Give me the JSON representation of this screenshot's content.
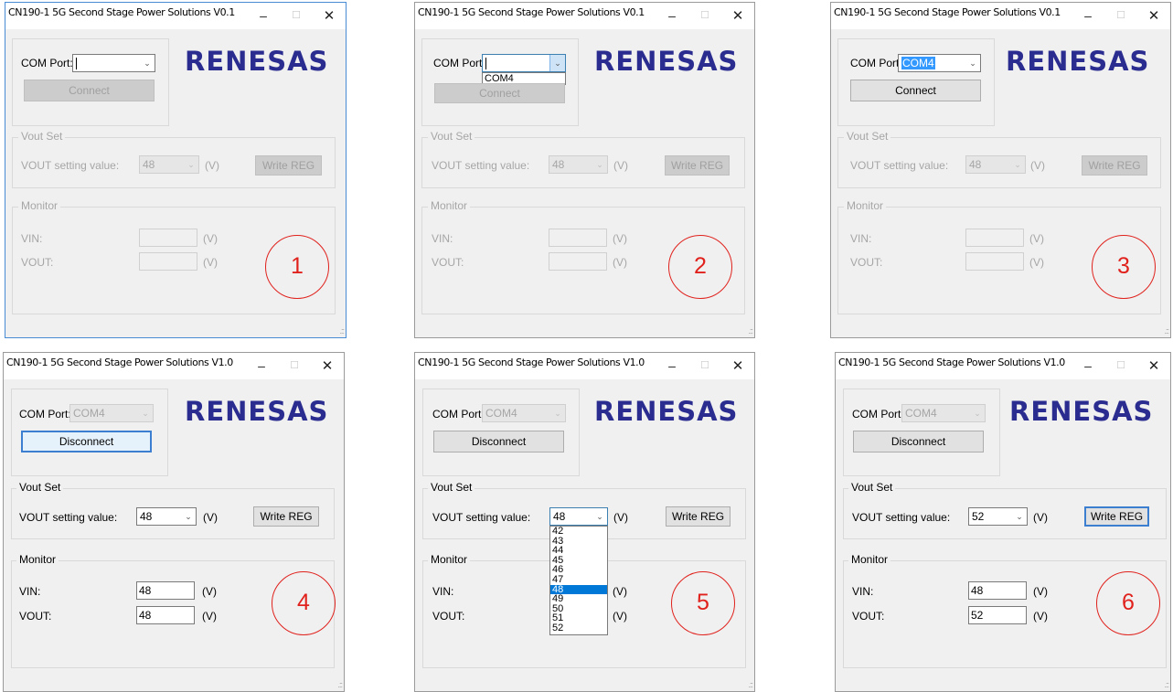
{
  "titles": {
    "v01": "CN190-1 5G Second Stage Power Solutions V0.1",
    "v10": "CN190-1 5G Second Stage Power Solutions V1.0"
  },
  "controls": {
    "minimize": "–",
    "maximize": "☐",
    "close": "✕",
    "grip": ".::",
    "dropdown_arrow": "⌄"
  },
  "labels": {
    "com_port": "COM Port:",
    "vout_set": "Vout Set",
    "vout_setting_value": "VOUT setting value:",
    "unit_v": "(V)",
    "monitor": "Monitor",
    "vin": "VIN:",
    "vout": "VOUT:",
    "connect": "Connect",
    "disconnect": "Disconnect",
    "write_reg": "Write REG"
  },
  "logo": "RENESAS",
  "colors": {
    "logo": "#2a2c8f",
    "annotation": "#e0211c",
    "highlight": "#3399ff",
    "active_border": "#4a8bd6"
  },
  "com_options": [
    "COM4"
  ],
  "vout_options": [
    "42",
    "43",
    "44",
    "45",
    "46",
    "47",
    "48",
    "49",
    "50",
    "51",
    "52"
  ],
  "panels": [
    {
      "step": "1",
      "com": "",
      "vout_sel": "48",
      "vin": "",
      "vout": ""
    },
    {
      "step": "2",
      "com": "",
      "vout_sel": "48",
      "vin": "",
      "vout": ""
    },
    {
      "step": "3",
      "com": "COM4",
      "vout_sel": "48",
      "vin": "",
      "vout": ""
    },
    {
      "step": "4",
      "com": "COM4",
      "vout_sel": "48",
      "vin": "48",
      "vout": "48"
    },
    {
      "step": "5",
      "com": "COM4",
      "vout_sel": "48",
      "vin": "",
      "vout": ""
    },
    {
      "step": "6",
      "com": "COM4",
      "vout_sel": "52",
      "vin": "48",
      "vout": "52"
    }
  ]
}
